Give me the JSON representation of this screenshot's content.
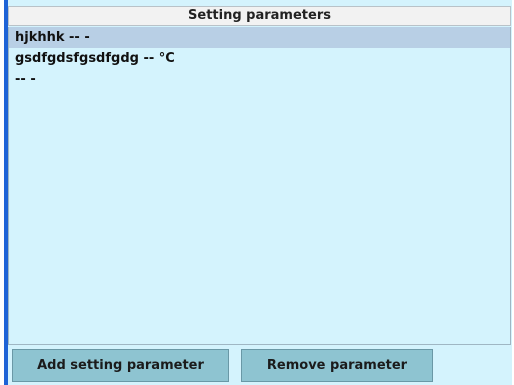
{
  "header": {
    "title": "Setting parameters"
  },
  "list": {
    "selected_index": 0,
    "items": [
      {
        "label": "hjkhhk -- -"
      },
      {
        "label": "gsdfgdsfgsdfgdg -- °C"
      },
      {
        "label": " -- -"
      }
    ]
  },
  "buttons": {
    "add_label": "Add setting parameter",
    "remove_label": "Remove parameter"
  },
  "colors": {
    "panel_bg": "#d4f3fd",
    "selection_bg": "#b8cfe5",
    "button_bg": "#8ec4d1",
    "accent": "#1e63d6"
  }
}
